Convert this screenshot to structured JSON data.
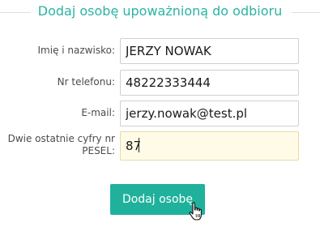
{
  "header": {
    "title": "Dodaj osobę upoważnioną do odbioru"
  },
  "form": {
    "fields": [
      {
        "label": "Imię i nazwisko:",
        "value": "JERZY NOWAK"
      },
      {
        "label": "Nr telefonu:",
        "value": "48222333444"
      },
      {
        "label": "E-mail:",
        "value": "jerzy.nowak@test.pl"
      },
      {
        "label": "Dwie ostatnie cyfry nr PESEL:",
        "value": "87"
      }
    ],
    "submit_label": "Dodaj osobę"
  },
  "colors": {
    "accent": "#1fb19c",
    "title": "#2bb3a3",
    "focused_field_bg": "#fffbe6"
  },
  "icons": {
    "pointer": "hand-pointer-icon"
  }
}
